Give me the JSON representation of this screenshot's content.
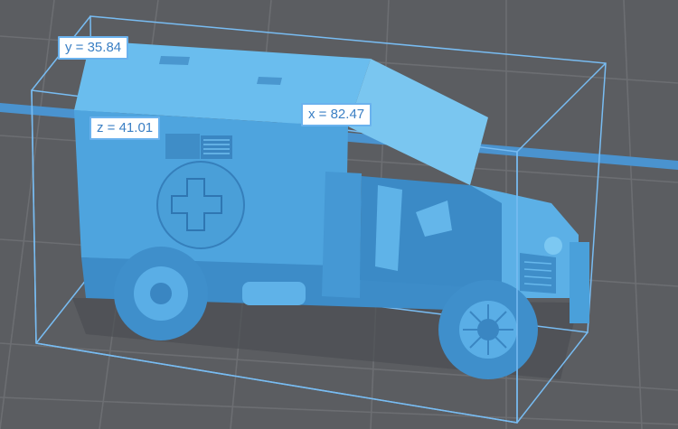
{
  "viewport": {
    "background": "#5b5d61",
    "grid_color": "#6c6e72",
    "axis_color": "#4a93cf",
    "bbox_color": "#78bcf2",
    "model_color": "#5fb0e6"
  },
  "dimensions": {
    "y_label": "y = 35.84",
    "z_label": "z = 41.01",
    "x_label": "x = 82.47"
  }
}
